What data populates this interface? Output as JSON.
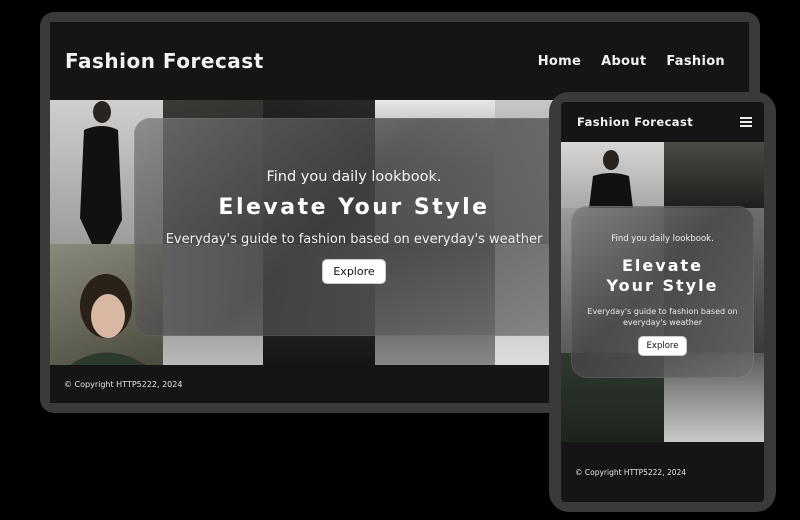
{
  "desktop": {
    "brand": "Fashion Forecast",
    "nav": [
      {
        "label": "Home"
      },
      {
        "label": "About"
      },
      {
        "label": "Fashion"
      }
    ],
    "hero": {
      "tagline": "Find you daily lookbook.",
      "headline": "Elevate Your Style",
      "subtitle": "Everyday's guide to fashion based on everyday's weather",
      "cta": "Explore"
    },
    "footer": {
      "copyright": "© Copyright HTTP5222, 2024"
    }
  },
  "mobile": {
    "brand": "Fashion Forecast",
    "menu_icon": "hamburger-menu-icon",
    "hero": {
      "tagline": "Find you daily lookbook.",
      "headline_line1": "Elevate",
      "headline_line2": "Your Style",
      "subtitle": "Everyday's guide to fashion based on everyday's weather",
      "cta": "Explore"
    },
    "footer": {
      "copyright": "© Copyright HTTP5222, 2024"
    }
  },
  "colors": {
    "background": "#000000",
    "device_frame": "#3a3a3a",
    "screen": "#151515",
    "button": "#ffffff"
  }
}
